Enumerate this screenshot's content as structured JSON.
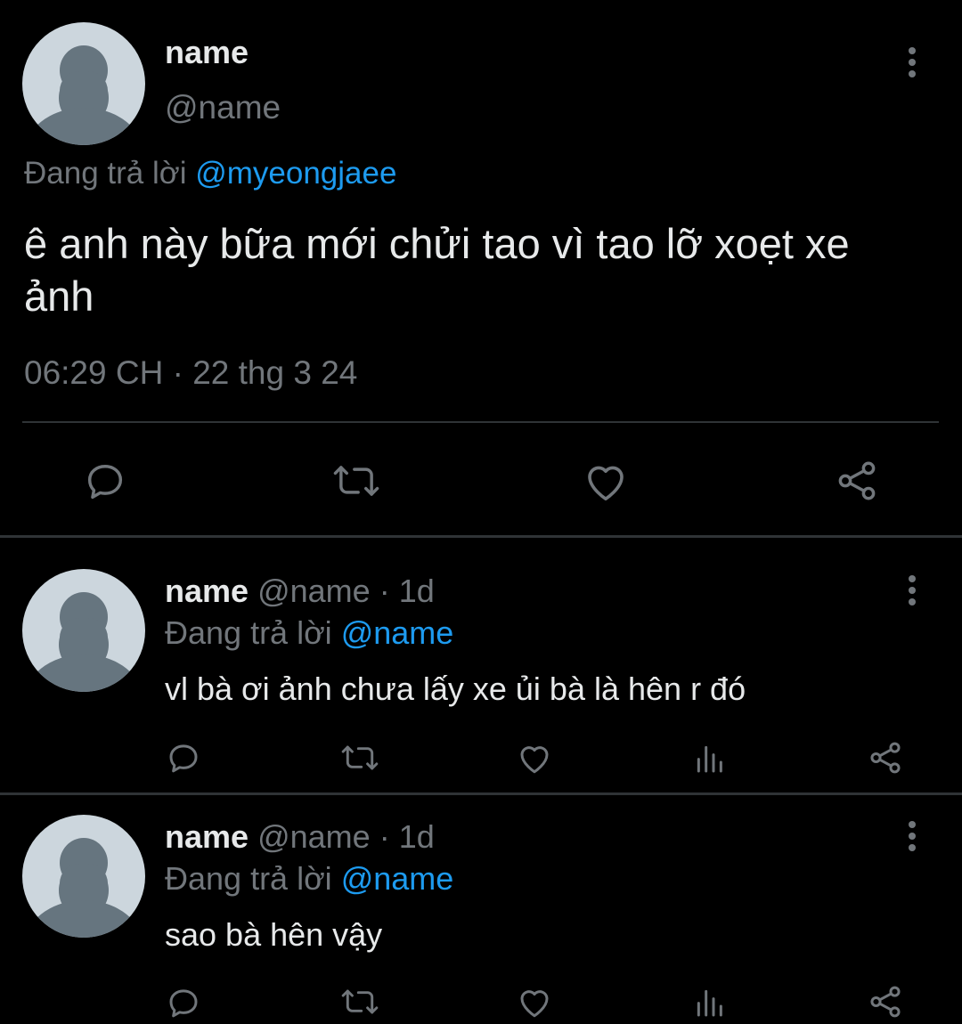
{
  "main_tweet": {
    "display_name": "name",
    "handle": "@name",
    "replying_prefix": "Đang trả lời",
    "replying_to": "@myeongjaee",
    "text": "ê anh này bữa mới chửi tao vì tao lỡ xoẹt xe ảnh",
    "timestamp": "06:29 CH · 22 thg 3 24",
    "actions": [
      "reply-icon",
      "retweet-icon",
      "like-icon",
      "share-icon"
    ]
  },
  "replies": [
    {
      "display_name": "name",
      "handle": "@name",
      "separator": "·",
      "age": "1d",
      "replying_prefix": "Đang trả lời",
      "replying_to": "@name",
      "text": "vl bà ơi ảnh chưa lấy xe ủi bà là hên r đó"
    },
    {
      "display_name": "name",
      "handle": "@name",
      "separator": "·",
      "age": "1d",
      "replying_prefix": "Đang trả lời",
      "replying_to": "@name",
      "text": "sao bà hên vậy"
    }
  ],
  "colors": {
    "background": "#000000",
    "text": "#e7e9ea",
    "muted": "#71767b",
    "link": "#1d9bf0",
    "divider": "#2f3336",
    "avatar_bg": "#ccd6dd",
    "avatar_fg": "#66757f"
  }
}
